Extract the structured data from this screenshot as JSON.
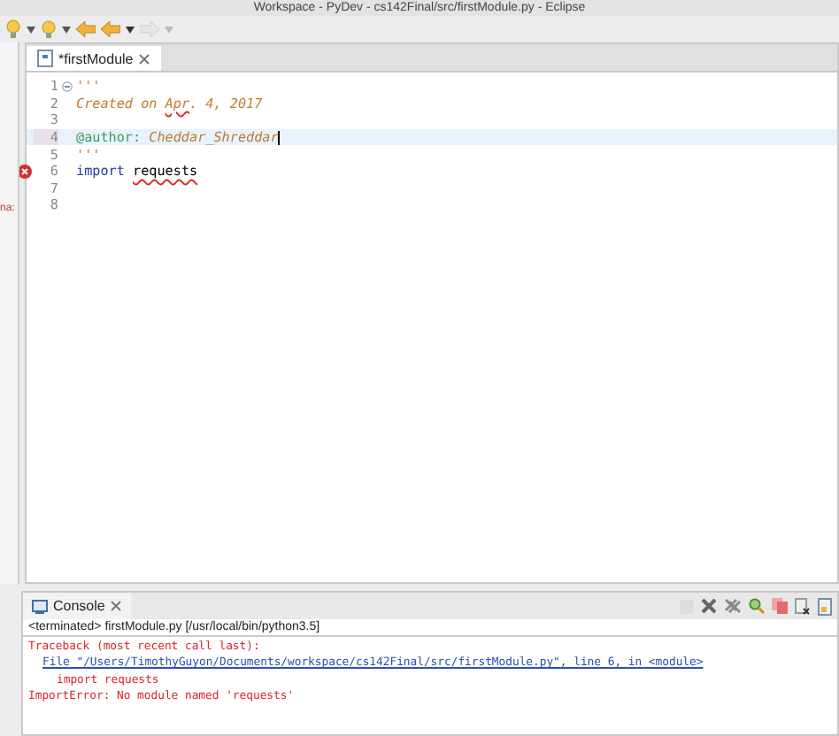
{
  "window": {
    "title": "Workspace - PyDev - cs142Final/src/firstModule.py - Eclipse"
  },
  "side_panel": {
    "text": "na:"
  },
  "editor": {
    "tab": {
      "label": "*firstModule",
      "selected": true
    },
    "lines": [
      {
        "number": "1",
        "fold": true,
        "current": false,
        "error": false,
        "segments": [
          {
            "text": "'''",
            "kind": "docstring",
            "squiggle": false
          }
        ]
      },
      {
        "number": "2",
        "fold": false,
        "current": false,
        "error": false,
        "segments": [
          {
            "text": "Created on ",
            "kind": "docstring",
            "squiggle": false
          },
          {
            "text": "Apr",
            "kind": "docstring",
            "squiggle": true
          },
          {
            "text": ". 4, 2017",
            "kind": "docstring",
            "squiggle": false
          }
        ]
      },
      {
        "number": "3",
        "fold": false,
        "current": false,
        "error": false
      },
      {
        "number": "4",
        "fold": false,
        "current": true,
        "error": false,
        "segments": [
          {
            "text": "@author:",
            "kind": "tag",
            "squiggle": false
          },
          {
            "text": " Cheddar_Shreddar",
            "kind": "docstring",
            "squiggle": false
          }
        ]
      },
      {
        "number": "5",
        "fold": false,
        "current": false,
        "error": false,
        "segments": [
          {
            "text": "'''",
            "kind": "docstring",
            "squiggle": false
          }
        ]
      },
      {
        "number": "6",
        "fold": false,
        "current": false,
        "error": true,
        "segments": [
          {
            "text": "import",
            "kind": "keyword",
            "squiggle": false
          },
          {
            "text": "requests",
            "kind": "plain",
            "squiggle": true,
            "space_before": true
          }
        ]
      },
      {
        "number": "7",
        "fold": false,
        "current": false,
        "error": false
      },
      {
        "number": "8",
        "fold": false,
        "current": false,
        "error": false
      }
    ]
  },
  "console": {
    "tab": {
      "label": "Console",
      "selected": true
    },
    "status": "<terminated> firstModule.py [/usr/local/bin/python3.5]",
    "output": [
      {
        "text": "Traceback (most recent call last):",
        "kind": "error"
      },
      {
        "text": "File \"/Users/TimothyGuyon/Documents/workspace/cs142Final/src/firstModule.py\", line 6, in <module>",
        "kind": "link"
      },
      {
        "text": "import requests",
        "kind": "error_indent"
      },
      {
        "text": "ImportError: No module named 'requests'",
        "kind": "error"
      }
    ]
  }
}
